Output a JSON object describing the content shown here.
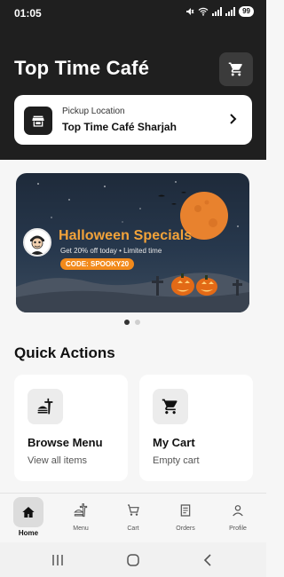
{
  "status": {
    "time": "01:05",
    "battery": "99"
  },
  "header": {
    "title": "Top Time Café"
  },
  "pickup": {
    "label": "Pickup Location",
    "value": "Top Time Café Sharjah"
  },
  "banner": {
    "title": "Halloween Specials",
    "subtitle": "Get 20% off today • Limited time",
    "code": "CODE: SPOOKY20"
  },
  "carousel": {
    "pages": 2,
    "active": 1
  },
  "quick_actions": {
    "title": "Quick Actions",
    "items": [
      {
        "title": "Browse Menu",
        "subtitle": "View all items",
        "icon": "food-icon"
      },
      {
        "title": "My Cart",
        "subtitle": "Empty cart",
        "icon": "cart-icon"
      }
    ]
  },
  "nav": {
    "items": [
      {
        "label": "Home",
        "icon": "home-icon",
        "active": true
      },
      {
        "label": "Menu",
        "icon": "menu-icon",
        "active": false
      },
      {
        "label": "Cart",
        "icon": "cart-icon",
        "active": false
      },
      {
        "label": "Orders",
        "icon": "orders-icon",
        "active": false
      },
      {
        "label": "Profile",
        "icon": "profile-icon",
        "active": false
      }
    ]
  },
  "colors": {
    "header_bg": "#1f1f1f",
    "promo_accent": "#f28a1b",
    "promo_title": "#f3a33a"
  }
}
